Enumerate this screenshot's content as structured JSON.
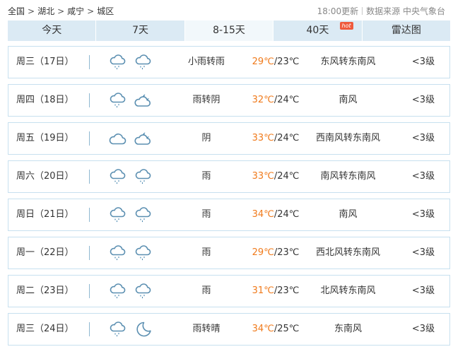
{
  "breadcrumb": [
    "全国",
    "湖北",
    "咸宁",
    "城区"
  ],
  "breadcrumb_sep": ">",
  "update_time": "18:00更新",
  "source_label": "数据来源 中央气象台",
  "tabs": [
    {
      "label": "今天",
      "active": false,
      "hot": false
    },
    {
      "label": "7天",
      "active": false,
      "hot": false
    },
    {
      "label": "8-15天",
      "active": true,
      "hot": false
    },
    {
      "label": "40天",
      "active": false,
      "hot": true
    },
    {
      "label": "雷达图",
      "active": false,
      "hot": false
    }
  ],
  "hot_badge": "hot",
  "icon_colors": {
    "outline": "#5b8fb1",
    "accent": "#2f76a4"
  },
  "days": [
    {
      "day": "周三（17日）",
      "icons": [
        "rain-cloud-icon",
        "rain-cloud-icon"
      ],
      "desc": "小雨转雨",
      "hi": "29℃",
      "lo": "/23℃",
      "wind": "东风转东南风",
      "level": "<3级"
    },
    {
      "day": "周四（18日）",
      "icons": [
        "rain-cloud-icon",
        "cloudy-night-icon"
      ],
      "desc": "雨转阴",
      "hi": "32℃",
      "lo": "/24℃",
      "wind": "南风",
      "level": "<3级"
    },
    {
      "day": "周五（19日）",
      "icons": [
        "cloud-icon",
        "cloudy-night-icon"
      ],
      "desc": "阴",
      "hi": "33℃",
      "lo": "/24℃",
      "wind": "西南风转东南风",
      "level": "<3级"
    },
    {
      "day": "周六（20日）",
      "icons": [
        "rain-cloud-icon",
        "rain-cloud-icon"
      ],
      "desc": "雨",
      "hi": "33℃",
      "lo": "/24℃",
      "wind": "南风转东南风",
      "level": "<3级"
    },
    {
      "day": "周日（21日）",
      "icons": [
        "rain-cloud-icon",
        "rain-cloud-icon"
      ],
      "desc": "雨",
      "hi": "34℃",
      "lo": "/24℃",
      "wind": "南风",
      "level": "<3级"
    },
    {
      "day": "周一（22日）",
      "icons": [
        "rain-cloud-icon",
        "rain-cloud-icon"
      ],
      "desc": "雨",
      "hi": "29℃",
      "lo": "/23℃",
      "wind": "西北风转东南风",
      "level": "<3级"
    },
    {
      "day": "周二（23日）",
      "icons": [
        "rain-cloud-icon",
        "rain-cloud-icon"
      ],
      "desc": "雨",
      "hi": "31℃",
      "lo": "/23℃",
      "wind": "北风转东南风",
      "level": "<3级"
    },
    {
      "day": "周三（24日）",
      "icons": [
        "rain-cloud-icon",
        "moon-icon"
      ],
      "desc": "雨转晴",
      "hi": "34℃",
      "lo": "/25℃",
      "wind": "东南风",
      "level": "<3级"
    }
  ]
}
